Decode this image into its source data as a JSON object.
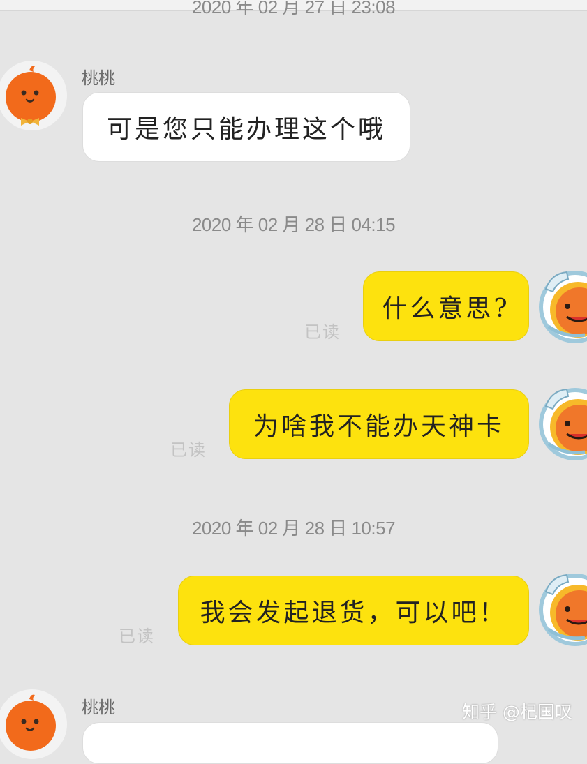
{
  "colors": {
    "background": "#e5e5e5",
    "incoming_bubble": "#ffffff",
    "outgoing_bubble": "#fde20e",
    "timestamp_text": "#8a8a8a",
    "read_receipt": "#c3c3c3"
  },
  "timestamps": [
    "2020 年 02 月 27 日  23:08",
    "2020 年 02 月 28 日  04:15",
    "2020 年 02 月 28 日  10:57"
  ],
  "messages": [
    {
      "sender": "桃桃",
      "direction": "incoming",
      "text": "可是您只能办理这个哦",
      "avatar": "orange-mascot-bowtie"
    },
    {
      "direction": "outgoing",
      "text": "什么意思?",
      "status": "已读",
      "avatar": "orange-mascot-helmet"
    },
    {
      "direction": "outgoing",
      "text": "为啥我不能办天神卡",
      "status": "已读",
      "avatar": "orange-mascot-helmet"
    },
    {
      "direction": "outgoing",
      "text": "我会发起退货，可以吧！",
      "status": "已读",
      "avatar": "orange-mascot-helmet"
    },
    {
      "sender": "桃桃",
      "direction": "incoming",
      "text": "",
      "avatar": "orange-mascot-bowtie"
    }
  ],
  "watermark": "知乎 @杞国叹"
}
